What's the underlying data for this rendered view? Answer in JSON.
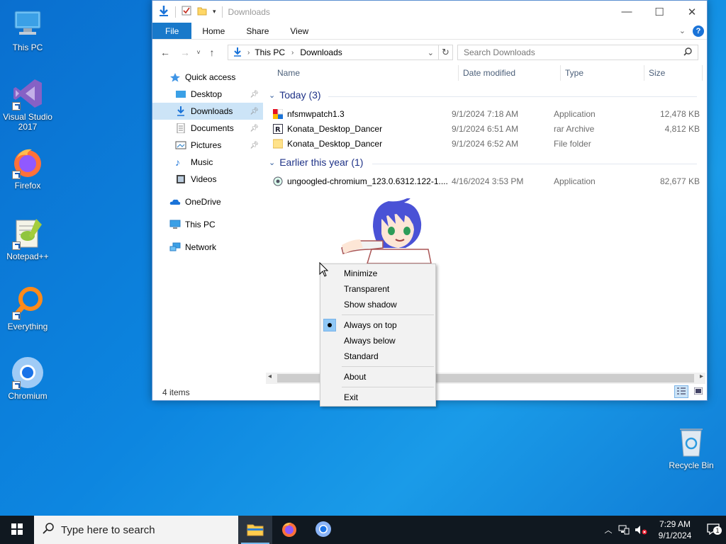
{
  "desktop": {
    "icons": [
      {
        "label": "This PC"
      },
      {
        "label": "Visual Studio 2017"
      },
      {
        "label": "Firefox"
      },
      {
        "label": "Notepad++"
      },
      {
        "label": "Everything"
      },
      {
        "label": "Chromium"
      },
      {
        "label": "Recycle Bin"
      }
    ]
  },
  "window": {
    "title": "Downloads",
    "ribbon_tabs": [
      "File",
      "Home",
      "Share",
      "View"
    ],
    "address": {
      "crumbs": [
        "This PC",
        "Downloads"
      ]
    },
    "search_placeholder": "Search Downloads",
    "nav": {
      "quick_access": "Quick access",
      "items": [
        "Desktop",
        "Downloads",
        "Documents",
        "Pictures",
        "Music",
        "Videos"
      ],
      "onedrive": "OneDrive",
      "thispc": "This PC",
      "network": "Network"
    },
    "columns": [
      "Name",
      "Date modified",
      "Type",
      "Size"
    ],
    "groups": [
      {
        "label": "Today (3)",
        "files": [
          {
            "name": "nfsmwpatch1.3",
            "date": "9/1/2024 7:18 AM",
            "type": "Application",
            "size": "12,478 KB"
          },
          {
            "name": "Konata_Desktop_Dancer",
            "date": "9/1/2024 6:51 AM",
            "type": "rar Archive",
            "size": "4,812 KB"
          },
          {
            "name": "Konata_Desktop_Dancer",
            "date": "9/1/2024 6:52 AM",
            "type": "File folder",
            "size": ""
          }
        ]
      },
      {
        "label": "Earlier this year (1)",
        "files": [
          {
            "name": "ungoogled-chromium_123.0.6312.122-1....",
            "date": "4/16/2024 3:53 PM",
            "type": "Application",
            "size": "82,677 KB"
          }
        ]
      }
    ],
    "status": "4 items"
  },
  "context_menu": {
    "items": [
      "Minimize",
      "Transparent",
      "Show shadow",
      "Always on top",
      "Always below",
      "Standard",
      "About",
      "Exit"
    ],
    "checked": "Always on top"
  },
  "taskbar": {
    "search_placeholder": "Type here to search",
    "time": "7:29 AM",
    "date": "9/1/2024",
    "notification_count": "1"
  },
  "colors": {
    "accent": "#1979ca",
    "selection": "#cce4f7",
    "group_header": "#1e3287"
  }
}
